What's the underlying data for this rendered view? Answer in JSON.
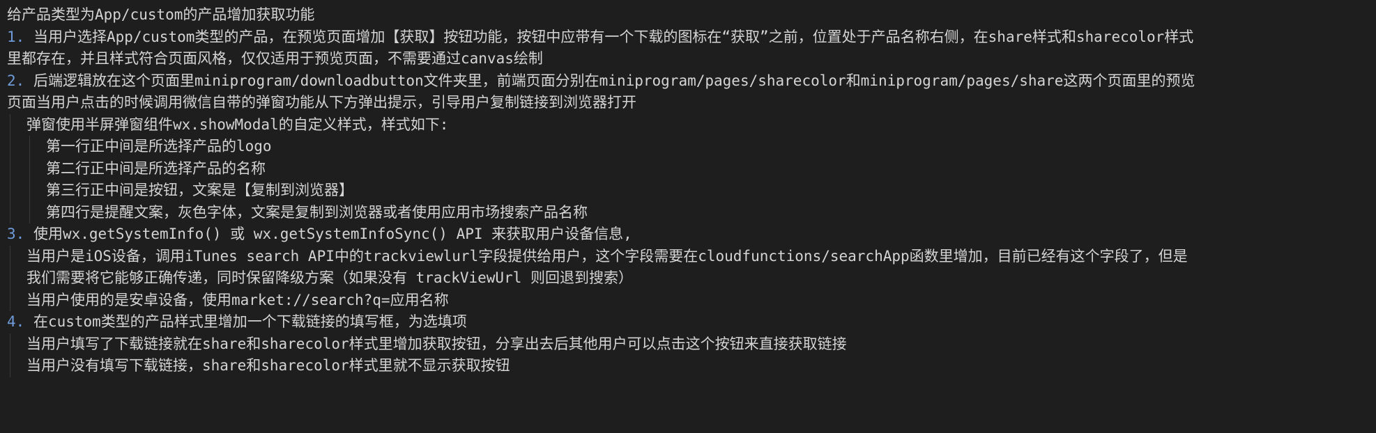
{
  "doc": {
    "title": "给产品类型为App/custom的产品增加获取功能",
    "item1": {
      "num": "1.",
      "line1": " 当用户选择App/custom类型的产品，在预览页面增加【获取】按钮功能，按钮中应带有一个下载的图标在“获取”之前，位置处于产品名称右侧，在share样式和sharecolor样式",
      "line2": "里都存在，并且样式符合页面风格，仅仅适用于预览页面，不需要通过canvas绘制"
    },
    "item2": {
      "num": "2.",
      "line1": " 后端逻辑放在这个页面里miniprogram/downloadbutton文件夹里，前端页面分别在miniprogram/pages/sharecolor和miniprogram/pages/share这两个页面里的预览",
      "line2": "页面当用户点击的时候调用微信自带的弹窗功能从下方弹出提示，引导用户复制链接到浏览器打开",
      "sub": "弹窗使用半屏弹窗组件wx.showModal的自定义样式，样式如下:",
      "subs": [
        "第一行正中间是所选择产品的logo",
        "第二行正中间是所选择产品的名称",
        "第三行正中间是按钮，文案是【复制到浏览器】",
        "第四行是提醒文案，灰色字体，文案是复制到浏览器或者使用应用市场搜索产品名称"
      ]
    },
    "item3": {
      "num": "3.",
      "line1": " 使用wx.getSystemInfo() 或 wx.getSystemInfoSync() API 来获取用户设备信息,",
      "sub1a": "当用户是iOS设备，调用iTunes search API中的trackviewlurl字段提供给用户，这个字段需要在cloudfunctions/searchApp函数里增加，目前已经有这个字段了，但是",
      "sub1b": "我们需要将它能够正确传递，同时保留降级方案（如果没有 trackViewUrl 则回退到搜索）",
      "sub2": "当用户使用的是安卓设备，使用market://search?q=应用名称"
    },
    "item4": {
      "num": "4.",
      "line1": " 在custom类型的产品样式里增加一个下载链接的填写框，为选填项",
      "sub1": "当用户填写了下载链接就在share和sharecolor样式里增加获取按钮，分享出去后其他用户可以点击这个按钮来直接获取链接",
      "sub2": "当用户没有填写下载链接，share和sharecolor样式里就不显示获取按钮"
    }
  }
}
